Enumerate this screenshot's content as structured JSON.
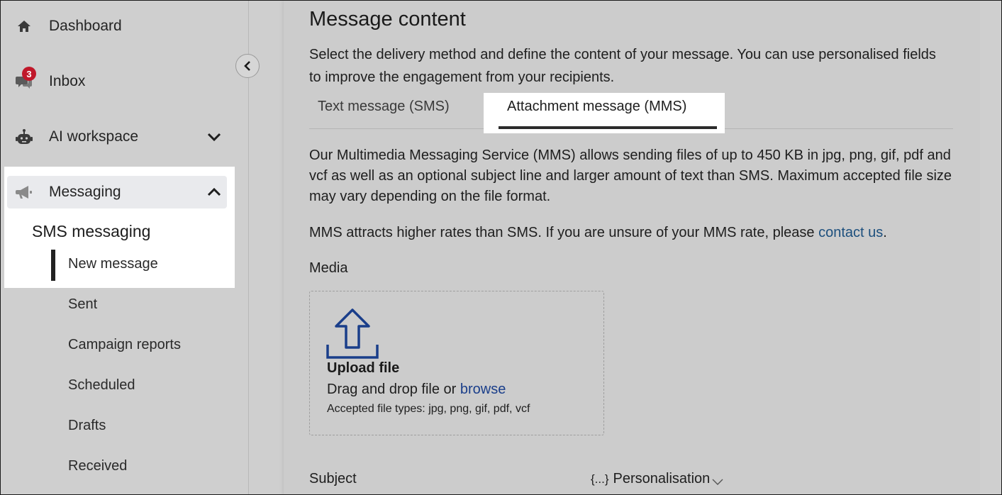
{
  "sidebar": {
    "items": [
      {
        "label": "Dashboard",
        "icon": "home-icon"
      },
      {
        "label": "Inbox",
        "icon": "chat-icon",
        "badge": "3"
      },
      {
        "label": "AI workspace",
        "icon": "robot-icon"
      },
      {
        "label": "Messaging",
        "icon": "megaphone-icon"
      }
    ],
    "section_title": "SMS messaging",
    "sub_items": [
      {
        "label": "New message",
        "active": true
      },
      {
        "label": "Sent"
      },
      {
        "label": "Campaign reports"
      },
      {
        "label": "Scheduled"
      },
      {
        "label": "Drafts"
      },
      {
        "label": "Received"
      }
    ]
  },
  "main": {
    "title": "Message content",
    "intro": "Select the delivery method and define the content of your message. You can use personalised fields to improve the engagement from your recipients.",
    "tabs": [
      {
        "label": "Text message (SMS)",
        "selected": false
      },
      {
        "label": "Attachment message (MMS)",
        "selected": true
      }
    ],
    "mms_description": "Our Multimedia Messaging Service (MMS) allows sending files of up to 450 KB in jpg, png, gif, pdf and vcf as well as an optional subject line and larger amount of text than SMS. Maximum accepted file size may vary depending on the file format.",
    "rates_text": "MMS attracts higher rates than SMS. If you are unsure of your MMS rate, please ",
    "rates_link": "contact us",
    "rates_end": ".",
    "media_label": "Media",
    "upload": {
      "title": "Upload file",
      "desc_prefix": "Drag and drop file or ",
      "browse_link": "browse",
      "accepted": "Accepted file types: jpg, png, gif, pdf, vcf"
    },
    "subject_label": "Subject",
    "personalisation": {
      "braces": "{...}",
      "label": "Personalisation"
    }
  },
  "colors": {
    "link": "#1c4f7d",
    "badge": "#c0182a",
    "upload_icon": "#1a3e8a"
  }
}
